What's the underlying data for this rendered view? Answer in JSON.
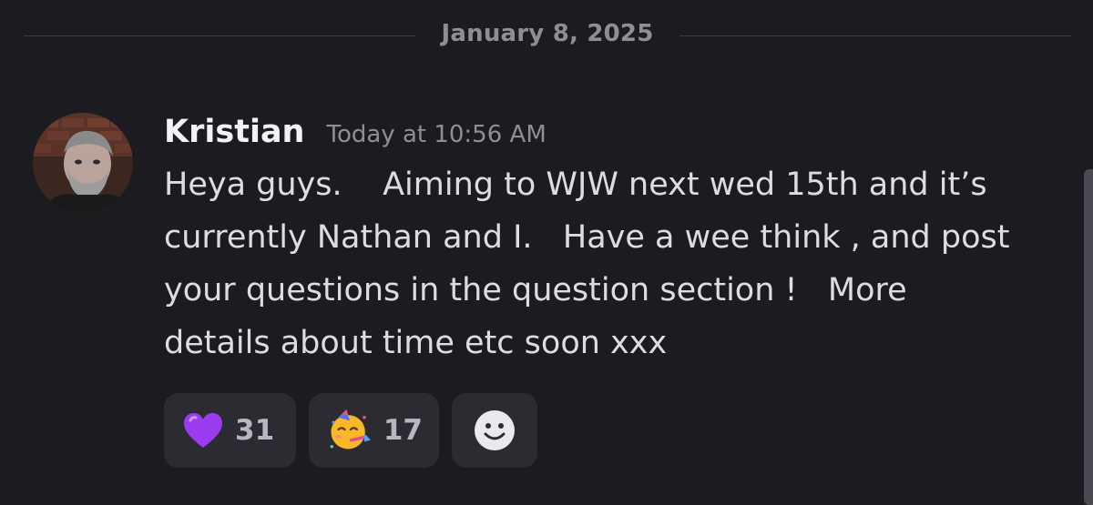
{
  "divider": {
    "date": "January 8, 2025"
  },
  "message": {
    "author": "Kristian",
    "timestamp": "Today at 10:56 AM",
    "text": "Heya guys.    Aiming to WJW next wed 15th and it’s\ncurrently Nathan and I.   Have a wee think , and post\nyour questions in the question section !   More\ndetails about time etc soon xxx",
    "avatar_icon": "profile-photo-avatar"
  },
  "reactions": [
    {
      "icon": "purple-heart-emoji",
      "count": "31",
      "color": "#9b3cf0"
    },
    {
      "icon": "partying-face-emoji",
      "count": "17",
      "color": "#f7b928"
    }
  ],
  "add_reaction_icon": "smiley-add-reaction-icon",
  "colors": {
    "background": "#1c1c20",
    "reaction_bg": "#2b2b31",
    "muted_text": "#8e8e97"
  }
}
